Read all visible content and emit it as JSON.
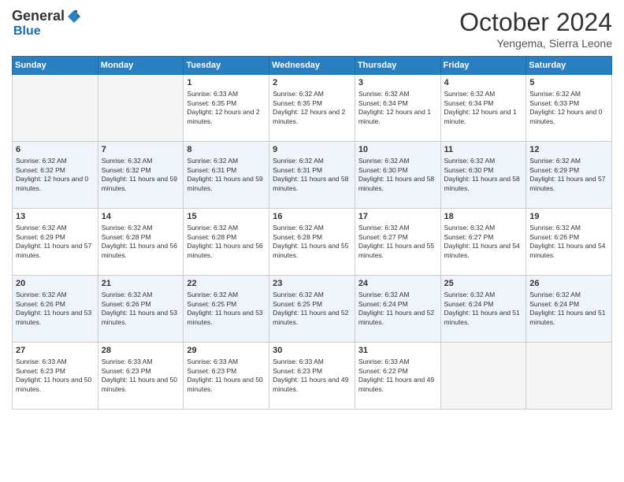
{
  "header": {
    "logo_general": "General",
    "logo_blue": "Blue",
    "month_title": "October 2024",
    "location": "Yengema, Sierra Leone"
  },
  "days_of_week": [
    "Sunday",
    "Monday",
    "Tuesday",
    "Wednesday",
    "Thursday",
    "Friday",
    "Saturday"
  ],
  "weeks": [
    [
      {
        "day": "",
        "empty": true
      },
      {
        "day": "",
        "empty": true
      },
      {
        "day": "1",
        "sunrise": "6:33 AM",
        "sunset": "6:35 PM",
        "daylight": "12 hours and 2 minutes."
      },
      {
        "day": "2",
        "sunrise": "6:32 AM",
        "sunset": "6:35 PM",
        "daylight": "12 hours and 2 minutes."
      },
      {
        "day": "3",
        "sunrise": "6:32 AM",
        "sunset": "6:34 PM",
        "daylight": "12 hours and 1 minute."
      },
      {
        "day": "4",
        "sunrise": "6:32 AM",
        "sunset": "6:34 PM",
        "daylight": "12 hours and 1 minute."
      },
      {
        "day": "5",
        "sunrise": "6:32 AM",
        "sunset": "6:33 PM",
        "daylight": "12 hours and 0 minutes."
      }
    ],
    [
      {
        "day": "6",
        "sunrise": "6:32 AM",
        "sunset": "6:32 PM",
        "daylight": "12 hours and 0 minutes."
      },
      {
        "day": "7",
        "sunrise": "6:32 AM",
        "sunset": "6:32 PM",
        "daylight": "11 hours and 59 minutes."
      },
      {
        "day": "8",
        "sunrise": "6:32 AM",
        "sunset": "6:31 PM",
        "daylight": "11 hours and 59 minutes."
      },
      {
        "day": "9",
        "sunrise": "6:32 AM",
        "sunset": "6:31 PM",
        "daylight": "11 hours and 58 minutes."
      },
      {
        "day": "10",
        "sunrise": "6:32 AM",
        "sunset": "6:30 PM",
        "daylight": "11 hours and 58 minutes."
      },
      {
        "day": "11",
        "sunrise": "6:32 AM",
        "sunset": "6:30 PM",
        "daylight": "11 hours and 58 minutes."
      },
      {
        "day": "12",
        "sunrise": "6:32 AM",
        "sunset": "6:29 PM",
        "daylight": "11 hours and 57 minutes."
      }
    ],
    [
      {
        "day": "13",
        "sunrise": "6:32 AM",
        "sunset": "6:29 PM",
        "daylight": "11 hours and 57 minutes."
      },
      {
        "day": "14",
        "sunrise": "6:32 AM",
        "sunset": "6:28 PM",
        "daylight": "11 hours and 56 minutes."
      },
      {
        "day": "15",
        "sunrise": "6:32 AM",
        "sunset": "6:28 PM",
        "daylight": "11 hours and 56 minutes."
      },
      {
        "day": "16",
        "sunrise": "6:32 AM",
        "sunset": "6:28 PM",
        "daylight": "11 hours and 55 minutes."
      },
      {
        "day": "17",
        "sunrise": "6:32 AM",
        "sunset": "6:27 PM",
        "daylight": "11 hours and 55 minutes."
      },
      {
        "day": "18",
        "sunrise": "6:32 AM",
        "sunset": "6:27 PM",
        "daylight": "11 hours and 54 minutes."
      },
      {
        "day": "19",
        "sunrise": "6:32 AM",
        "sunset": "6:26 PM",
        "daylight": "11 hours and 54 minutes."
      }
    ],
    [
      {
        "day": "20",
        "sunrise": "6:32 AM",
        "sunset": "6:26 PM",
        "daylight": "11 hours and 53 minutes."
      },
      {
        "day": "21",
        "sunrise": "6:32 AM",
        "sunset": "6:26 PM",
        "daylight": "11 hours and 53 minutes."
      },
      {
        "day": "22",
        "sunrise": "6:32 AM",
        "sunset": "6:25 PM",
        "daylight": "11 hours and 53 minutes."
      },
      {
        "day": "23",
        "sunrise": "6:32 AM",
        "sunset": "6:25 PM",
        "daylight": "11 hours and 52 minutes."
      },
      {
        "day": "24",
        "sunrise": "6:32 AM",
        "sunset": "6:24 PM",
        "daylight": "11 hours and 52 minutes."
      },
      {
        "day": "25",
        "sunrise": "6:32 AM",
        "sunset": "6:24 PM",
        "daylight": "11 hours and 51 minutes."
      },
      {
        "day": "26",
        "sunrise": "6:32 AM",
        "sunset": "6:24 PM",
        "daylight": "11 hours and 51 minutes."
      }
    ],
    [
      {
        "day": "27",
        "sunrise": "6:33 AM",
        "sunset": "6:23 PM",
        "daylight": "11 hours and 50 minutes."
      },
      {
        "day": "28",
        "sunrise": "6:33 AM",
        "sunset": "6:23 PM",
        "daylight": "11 hours and 50 minutes."
      },
      {
        "day": "29",
        "sunrise": "6:33 AM",
        "sunset": "6:23 PM",
        "daylight": "11 hours and 50 minutes."
      },
      {
        "day": "30",
        "sunrise": "6:33 AM",
        "sunset": "6:23 PM",
        "daylight": "11 hours and 49 minutes."
      },
      {
        "day": "31",
        "sunrise": "6:33 AM",
        "sunset": "6:22 PM",
        "daylight": "11 hours and 49 minutes."
      },
      {
        "day": "",
        "empty": true
      },
      {
        "day": "",
        "empty": true
      }
    ]
  ]
}
